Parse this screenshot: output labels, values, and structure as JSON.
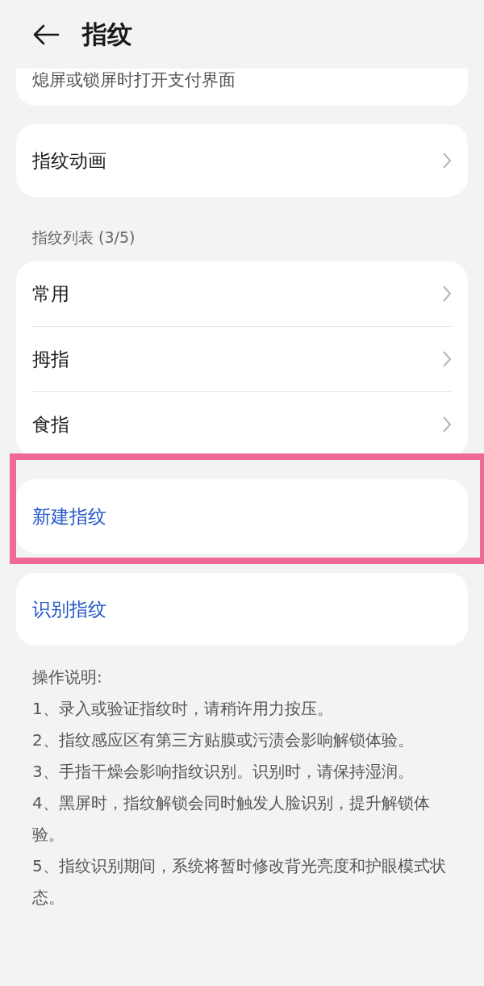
{
  "header": {
    "title": "指纹"
  },
  "partial_card": {
    "label": "熄屏或锁屏时打开支付界面"
  },
  "animation_item": {
    "label": "指纹动画"
  },
  "section_title": "指纹列表 (3/5)",
  "fingerprints": [
    {
      "name": "常用"
    },
    {
      "name": "拇指"
    },
    {
      "name": "食指"
    }
  ],
  "actions": [
    {
      "label": "新建指纹",
      "highlighted": true
    },
    {
      "label": "识别指纹",
      "highlighted": false
    }
  ],
  "notes": {
    "title": "操作说明:",
    "items": [
      "1、录入或验证指纹时，请稍许用力按压。",
      "2、指纹感应区有第三方贴膜或污渍会影响解锁体验。",
      "3、手指干燥会影响指纹识别。识别时，请保持湿润。",
      "4、黑屏时，指纹解锁会同时触发人脸识别，提升解锁体验。",
      "5、指纹识别期间，系统将暂时修改背光亮度和护眼模式状态。"
    ]
  }
}
